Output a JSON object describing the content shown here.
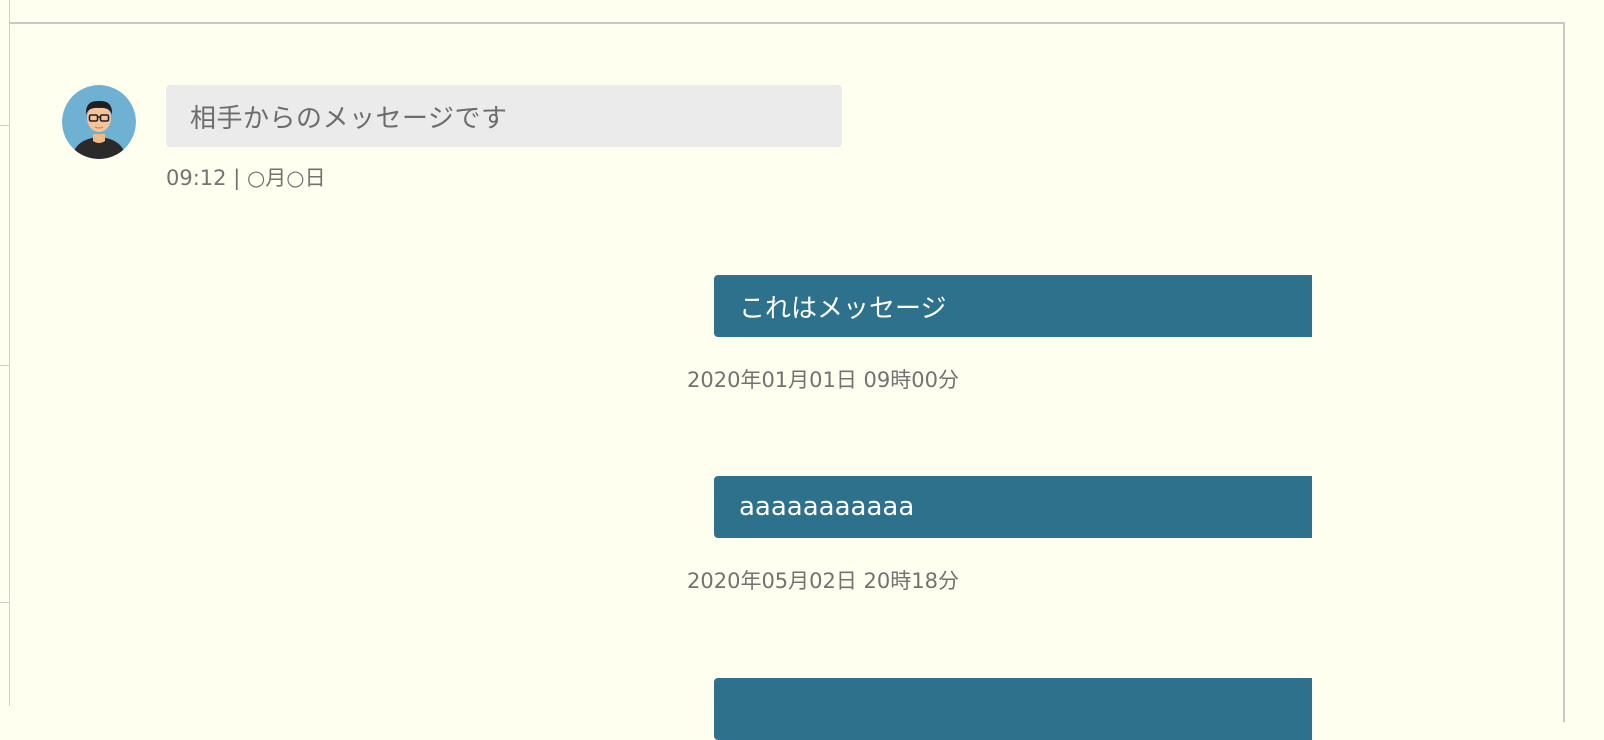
{
  "thread": {
    "incoming": [
      {
        "text": "相手からのメッセージです",
        "meta": "09:12 | ○月○日",
        "avatar_icon": "person-glasses-avatar-icon"
      }
    ],
    "outgoing": [
      {
        "text": "これはメッセージ",
        "timestamp": "2020年01月01日 09時00分"
      },
      {
        "text": "aaaaaaaaaaa",
        "timestamp": "2020年05月02日 20時18分"
      },
      {
        "text": "",
        "timestamp": ""
      }
    ]
  },
  "colors": {
    "page_background": "#fffff0",
    "incoming_bubble": "#ebebeb",
    "outgoing_bubble": "#2e718c",
    "meta_text": "#727272",
    "avatar_background": "#6fb1d3"
  }
}
